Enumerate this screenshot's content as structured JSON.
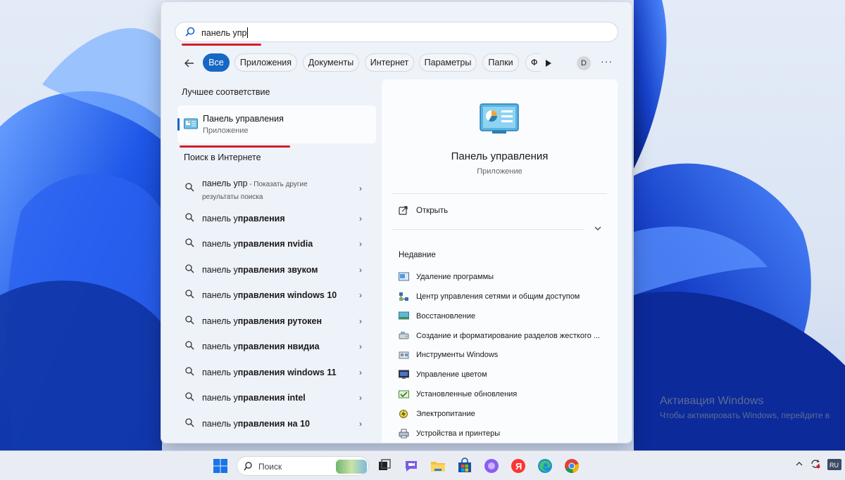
{
  "search": {
    "query": "панель упр"
  },
  "filters": {
    "chips": [
      "Все",
      "Приложения",
      "Документы",
      "Интернет",
      "Параметры",
      "Папки"
    ],
    "cut_chip": "Ф",
    "avatar": "D",
    "more": "···"
  },
  "best_match": {
    "title": "Лучшее соответствие",
    "name": "Панель управления",
    "type": "Приложение"
  },
  "web": {
    "title": "Поиск в Интернете",
    "first": {
      "query": "панель упр",
      "suffix": " - Показать другие",
      "suffix2": "результаты поиска"
    },
    "items": [
      {
        "prefix": "панель у",
        "bold": "правления"
      },
      {
        "prefix": "панель у",
        "bold": "правления nvidia"
      },
      {
        "prefix": "панель у",
        "bold": "правления звуком"
      },
      {
        "prefix": "панель у",
        "bold": "правления windows 10"
      },
      {
        "prefix": "панель у",
        "bold": "правления рутокен"
      },
      {
        "prefix": "панель у",
        "bold": "правления нвидиа"
      },
      {
        "prefix": "панель у",
        "bold": "правления windows 11"
      },
      {
        "prefix": "панель у",
        "bold": "правления intel"
      },
      {
        "prefix": "панель у",
        "bold": "правления на 10"
      }
    ]
  },
  "preview": {
    "name": "Панель управления",
    "type": "Приложение",
    "open_label": "Открыть",
    "recent_title": "Недавние",
    "recent": [
      "Удаление программы",
      "Центр управления сетями и общим доступом",
      "Восстановление",
      "Создание и форматирование разделов жесткого ...",
      "Инструменты Windows",
      "Управление цветом",
      "Установленные обновления",
      "Электропитание",
      "Устройства и принтеры"
    ]
  },
  "watermark": {
    "line1": "Активация Windows",
    "line2": "Чтобы активировать Windows, перейдите в"
  },
  "taskbar": {
    "search_placeholder": "Поиск",
    "icons": [
      "windows-start-icon",
      "task-view-icon",
      "teams-chat-icon",
      "file-explorer-icon",
      "microsoft-store-icon",
      "alice-icon",
      "yandex-browser-icon",
      "edge-icon",
      "chrome-icon"
    ],
    "tray_icons": [
      "chevron-up-icon",
      "sync-icon",
      "language-icon"
    ]
  },
  "colors": {
    "accent": "#1767c4",
    "highlight_red": "#d11f2a"
  }
}
